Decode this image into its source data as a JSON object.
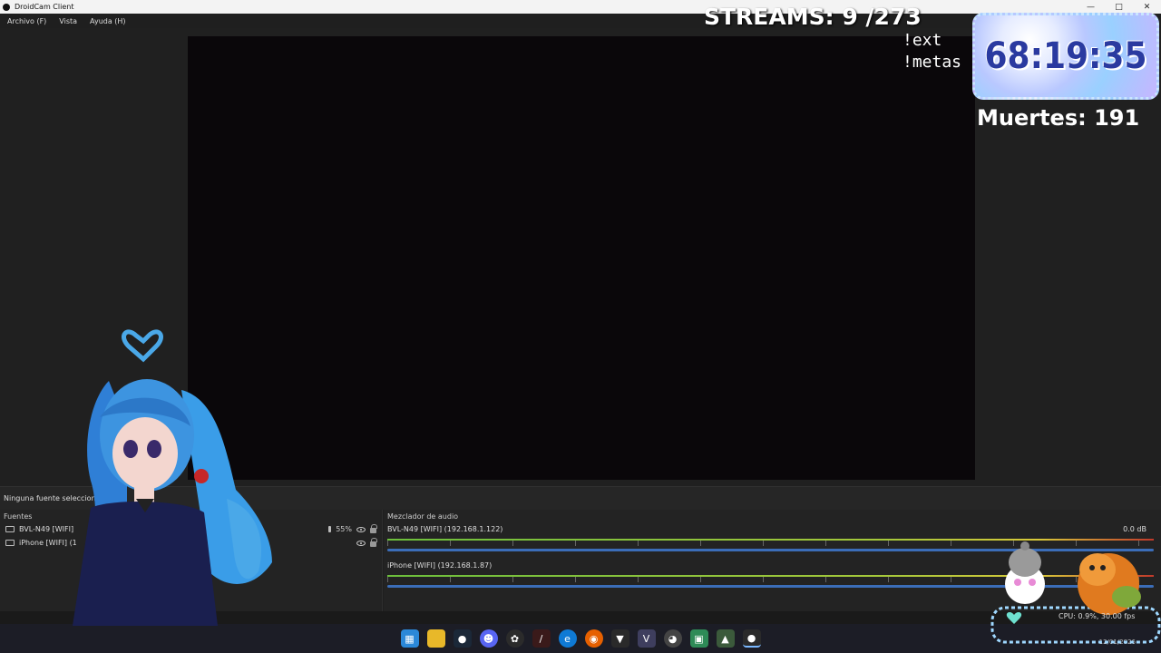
{
  "window": {
    "title": "DroidCam Client"
  },
  "menu": [
    "Archivo (F)",
    "Vista",
    "Ayuda (H)"
  ],
  "status": {
    "no_source_text": "Ninguna fuente seleccionad"
  },
  "sources": {
    "header": "Fuentes",
    "items": [
      {
        "label": "BVL-N49 [WIFI]",
        "volume": "55%"
      },
      {
        "label": "iPhone [WIFI] (1"
      }
    ]
  },
  "mixer": {
    "header": "Mezclador de audio",
    "channels": [
      {
        "name": "BVL-N49 [WIFI] (192.168.1.122)",
        "db": "0.0 dB"
      },
      {
        "name": "iPhone [WIFI] (192.168.1.87)"
      }
    ]
  },
  "overlay": {
    "streams": "STREAMS: 9 /273",
    "cmd1": "!ext",
    "cmd2": "!metas",
    "timer": "68:19:35",
    "deaths": "Muertes: 191"
  },
  "performance": {
    "cpu_text": "CPU: 0.9%, 30.00 fps"
  },
  "taskbar": {
    "icons": [
      "windows-start-icon",
      "file-explorer-icon",
      "steam-icon",
      "discord-icon",
      "chatgpt-icon",
      "app-icon",
      "edge-icon",
      "firefox-icon",
      "vtube-icon",
      "vscode-icon",
      "chrome-icon",
      "app2-icon",
      "app3-icon",
      "droidcam-icon"
    ],
    "date": "12/01/2026"
  },
  "colors": {
    "accent_blue": "#3b6db8",
    "meter_green": "#6cbf3c"
  }
}
